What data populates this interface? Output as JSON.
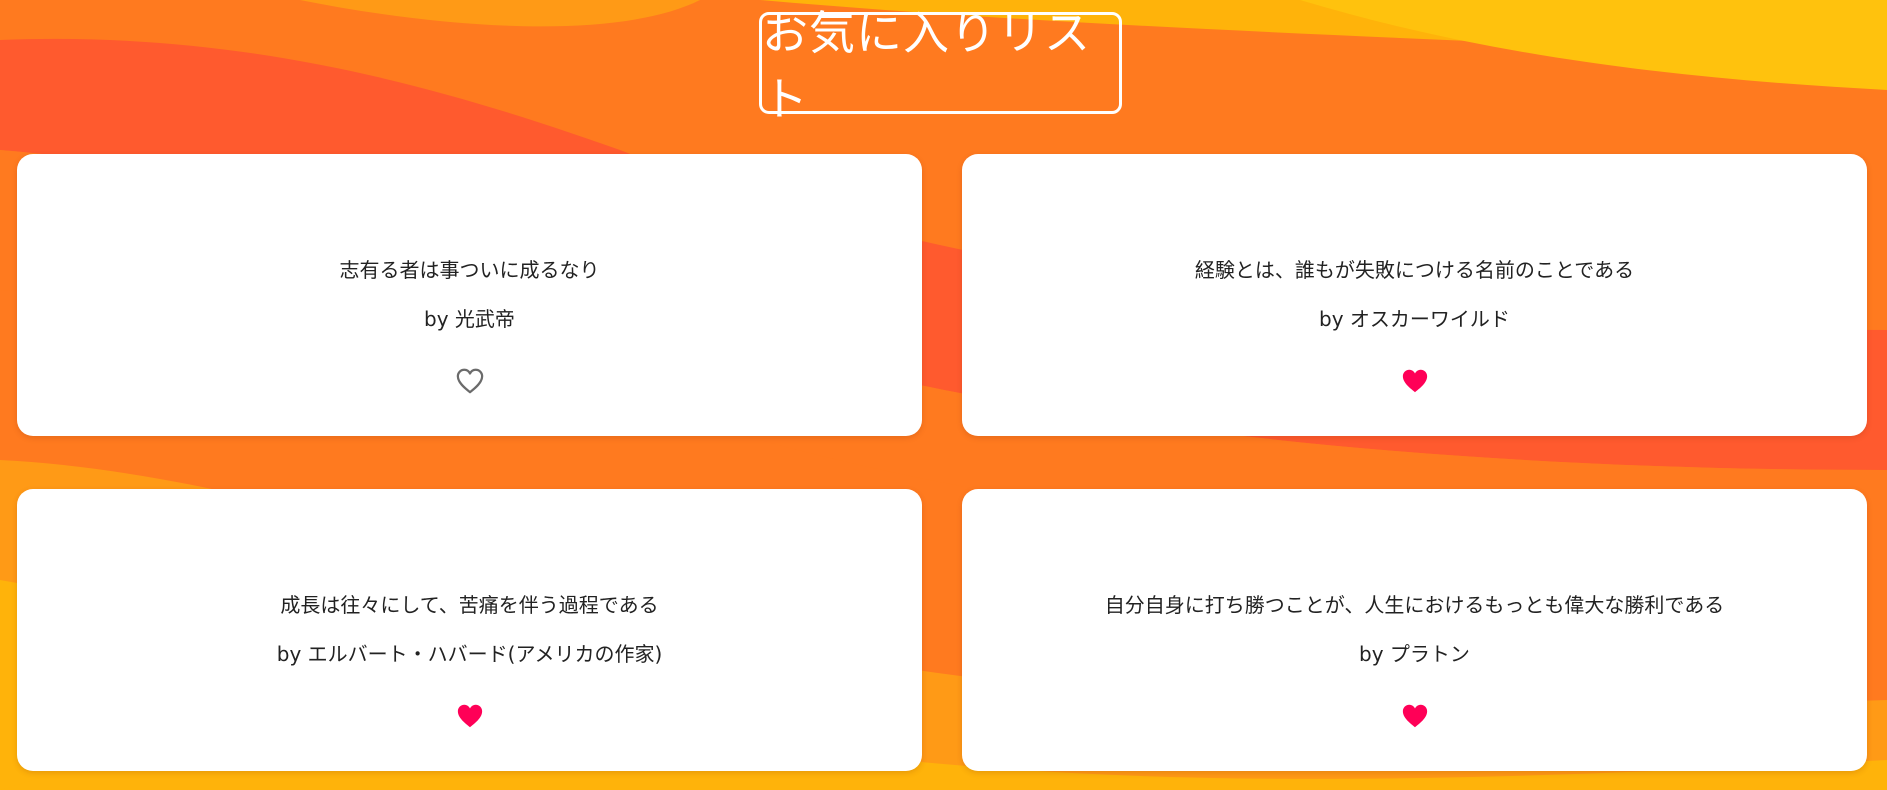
{
  "header": {
    "title": "お気に入りリスト"
  },
  "theme": {
    "accent": "#ff0057",
    "outline_heart": "#6b6b6b",
    "background_colors": [
      "#ff5a2e",
      "#ff7a1f",
      "#ff9a16",
      "#ffb30a"
    ]
  },
  "favorites": [
    {
      "quote": "志有る者は事ついに成るなり",
      "author": "by 光武帝",
      "liked": false,
      "heart_icon": "heart-outline-icon"
    },
    {
      "quote": "経験とは、誰もが失敗につける名前のことである",
      "author": "by オスカーワイルド",
      "liked": true,
      "heart_icon": "heart-filled-icon"
    },
    {
      "quote": "成長は往々にして、苦痛を伴う過程である",
      "author": "by エルバート・ハバード(アメリカの作家)",
      "liked": true,
      "heart_icon": "heart-filled-icon"
    },
    {
      "quote": "自分自身に打ち勝つことが、人生におけるもっとも偉大な勝利である",
      "author": "by プラトン",
      "liked": true,
      "heart_icon": "heart-filled-icon"
    }
  ]
}
